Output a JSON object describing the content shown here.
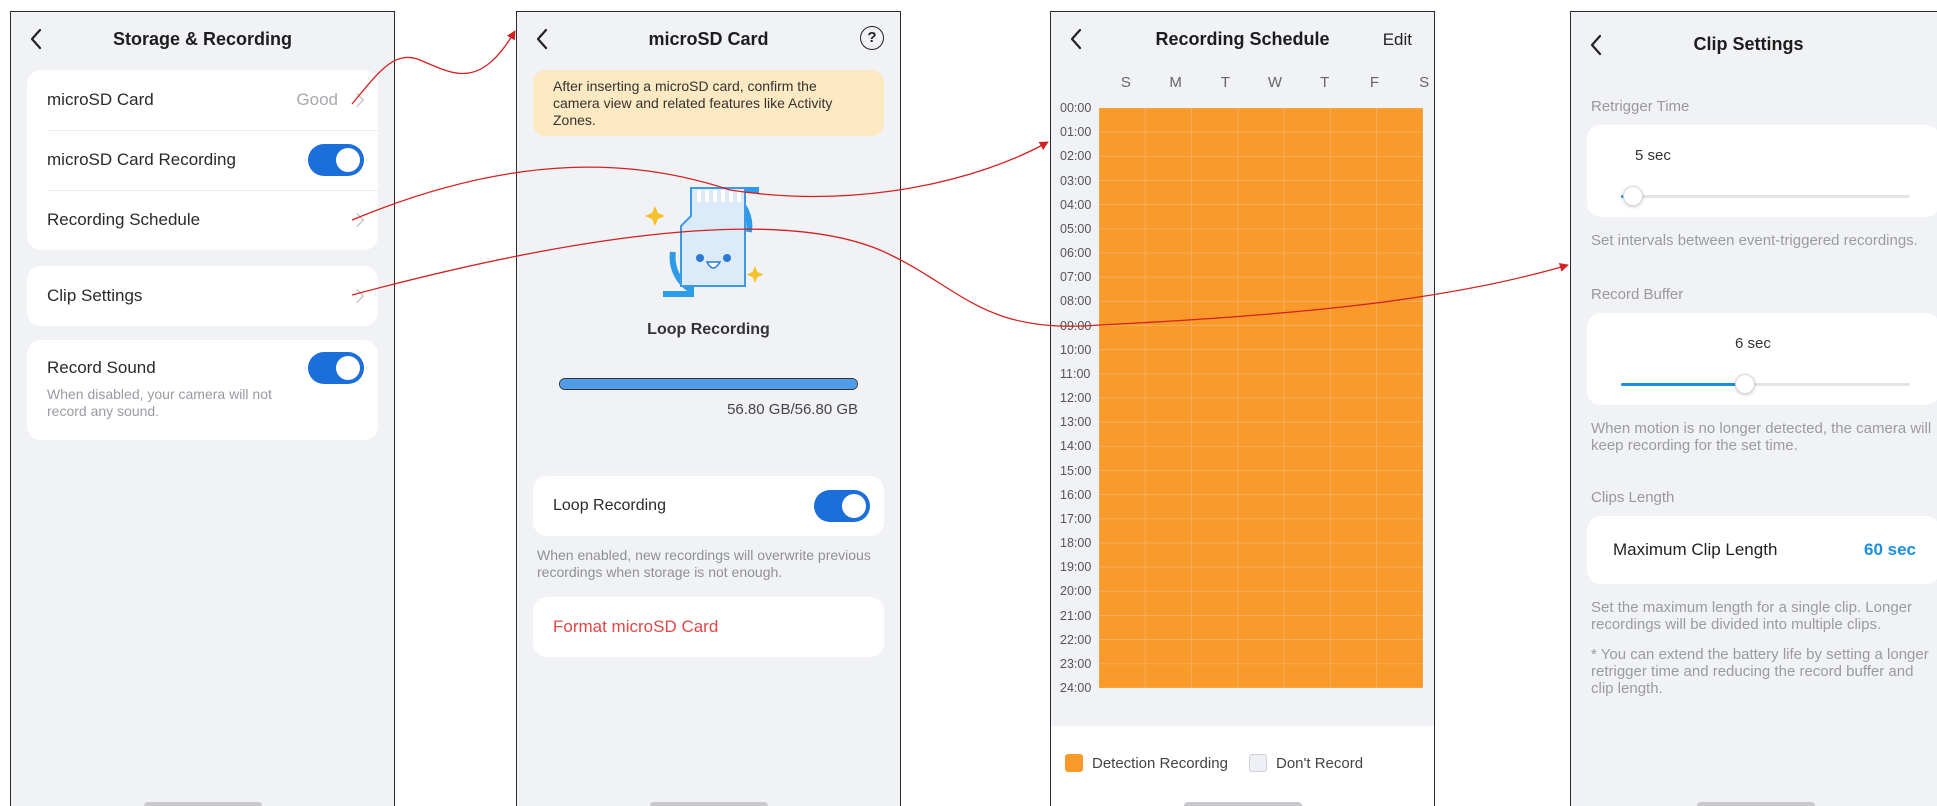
{
  "panel1": {
    "title": "Storage & Recording",
    "items": [
      {
        "label": "microSD Card",
        "value": "Good"
      },
      {
        "label": "microSD Card Recording"
      },
      {
        "label": "Recording Schedule"
      },
      {
        "label": "Clip Settings"
      },
      {
        "label": "Record Sound",
        "description": "When disabled, your camera will not record any sound."
      }
    ]
  },
  "panel2": {
    "title": "microSD Card",
    "notice": "After inserting a microSD card, confirm the camera view and related features like Activity Zones.",
    "illustration_label": "Loop Recording",
    "storage_used_fraction": 1.0,
    "storage_text": "56.80 GB/56.80 GB",
    "loop_label": "Loop Recording",
    "loop_hint": "When enabled, new recordings will overwrite previous recordings when storage is not enough.",
    "format_label": "Format microSD Card",
    "help_icon": "question-circle-icon"
  },
  "panel3": {
    "title": "Recording Schedule",
    "edit_label": "Edit",
    "days": [
      "S",
      "M",
      "T",
      "W",
      "T",
      "F",
      "S"
    ],
    "hours": [
      "00:00",
      "01:00",
      "02:00",
      "03:00",
      "04:00",
      "05:00",
      "06:00",
      "07:00",
      "08:00",
      "09:00",
      "10:00",
      "11:00",
      "12:00",
      "13:00",
      "14:00",
      "15:00",
      "16:00",
      "17:00",
      "18:00",
      "19:00",
      "20:00",
      "21:00",
      "22:00",
      "23:00",
      "24:00"
    ],
    "legend": [
      {
        "label": "Detection Recording",
        "color": "#f99a2a"
      },
      {
        "label": "Don't Record",
        "color": "#eef0f5"
      }
    ]
  },
  "panel4": {
    "title": "Clip Settings",
    "retrigger_label": "Retrigger Time",
    "retrigger_value": "5 sec",
    "retrigger_fraction": 0.04,
    "retrigger_desc": "Set intervals between event-triggered recordings.",
    "buffer_label": "Record Buffer",
    "buffer_value": "6 sec",
    "buffer_fraction": 0.43,
    "buffer_desc": "When motion is no longer detected, the camera will keep recording for the set time.",
    "clips_length_label": "Clips Length",
    "max_clip_label": "Maximum Clip Length",
    "max_clip_value": "60 sec",
    "max_clip_desc": "Set the maximum length for a single clip. Longer recordings will be divided into multiple clips.",
    "footnote": "* You can extend the battery life by setting a longer retrigger time and reducing the record buffer and clip length."
  },
  "colors": {
    "accent_blue": "#1c6ed8",
    "schedule_orange": "#f99a2a",
    "arrow_red": "#d42020",
    "danger_red": "#e04747"
  }
}
